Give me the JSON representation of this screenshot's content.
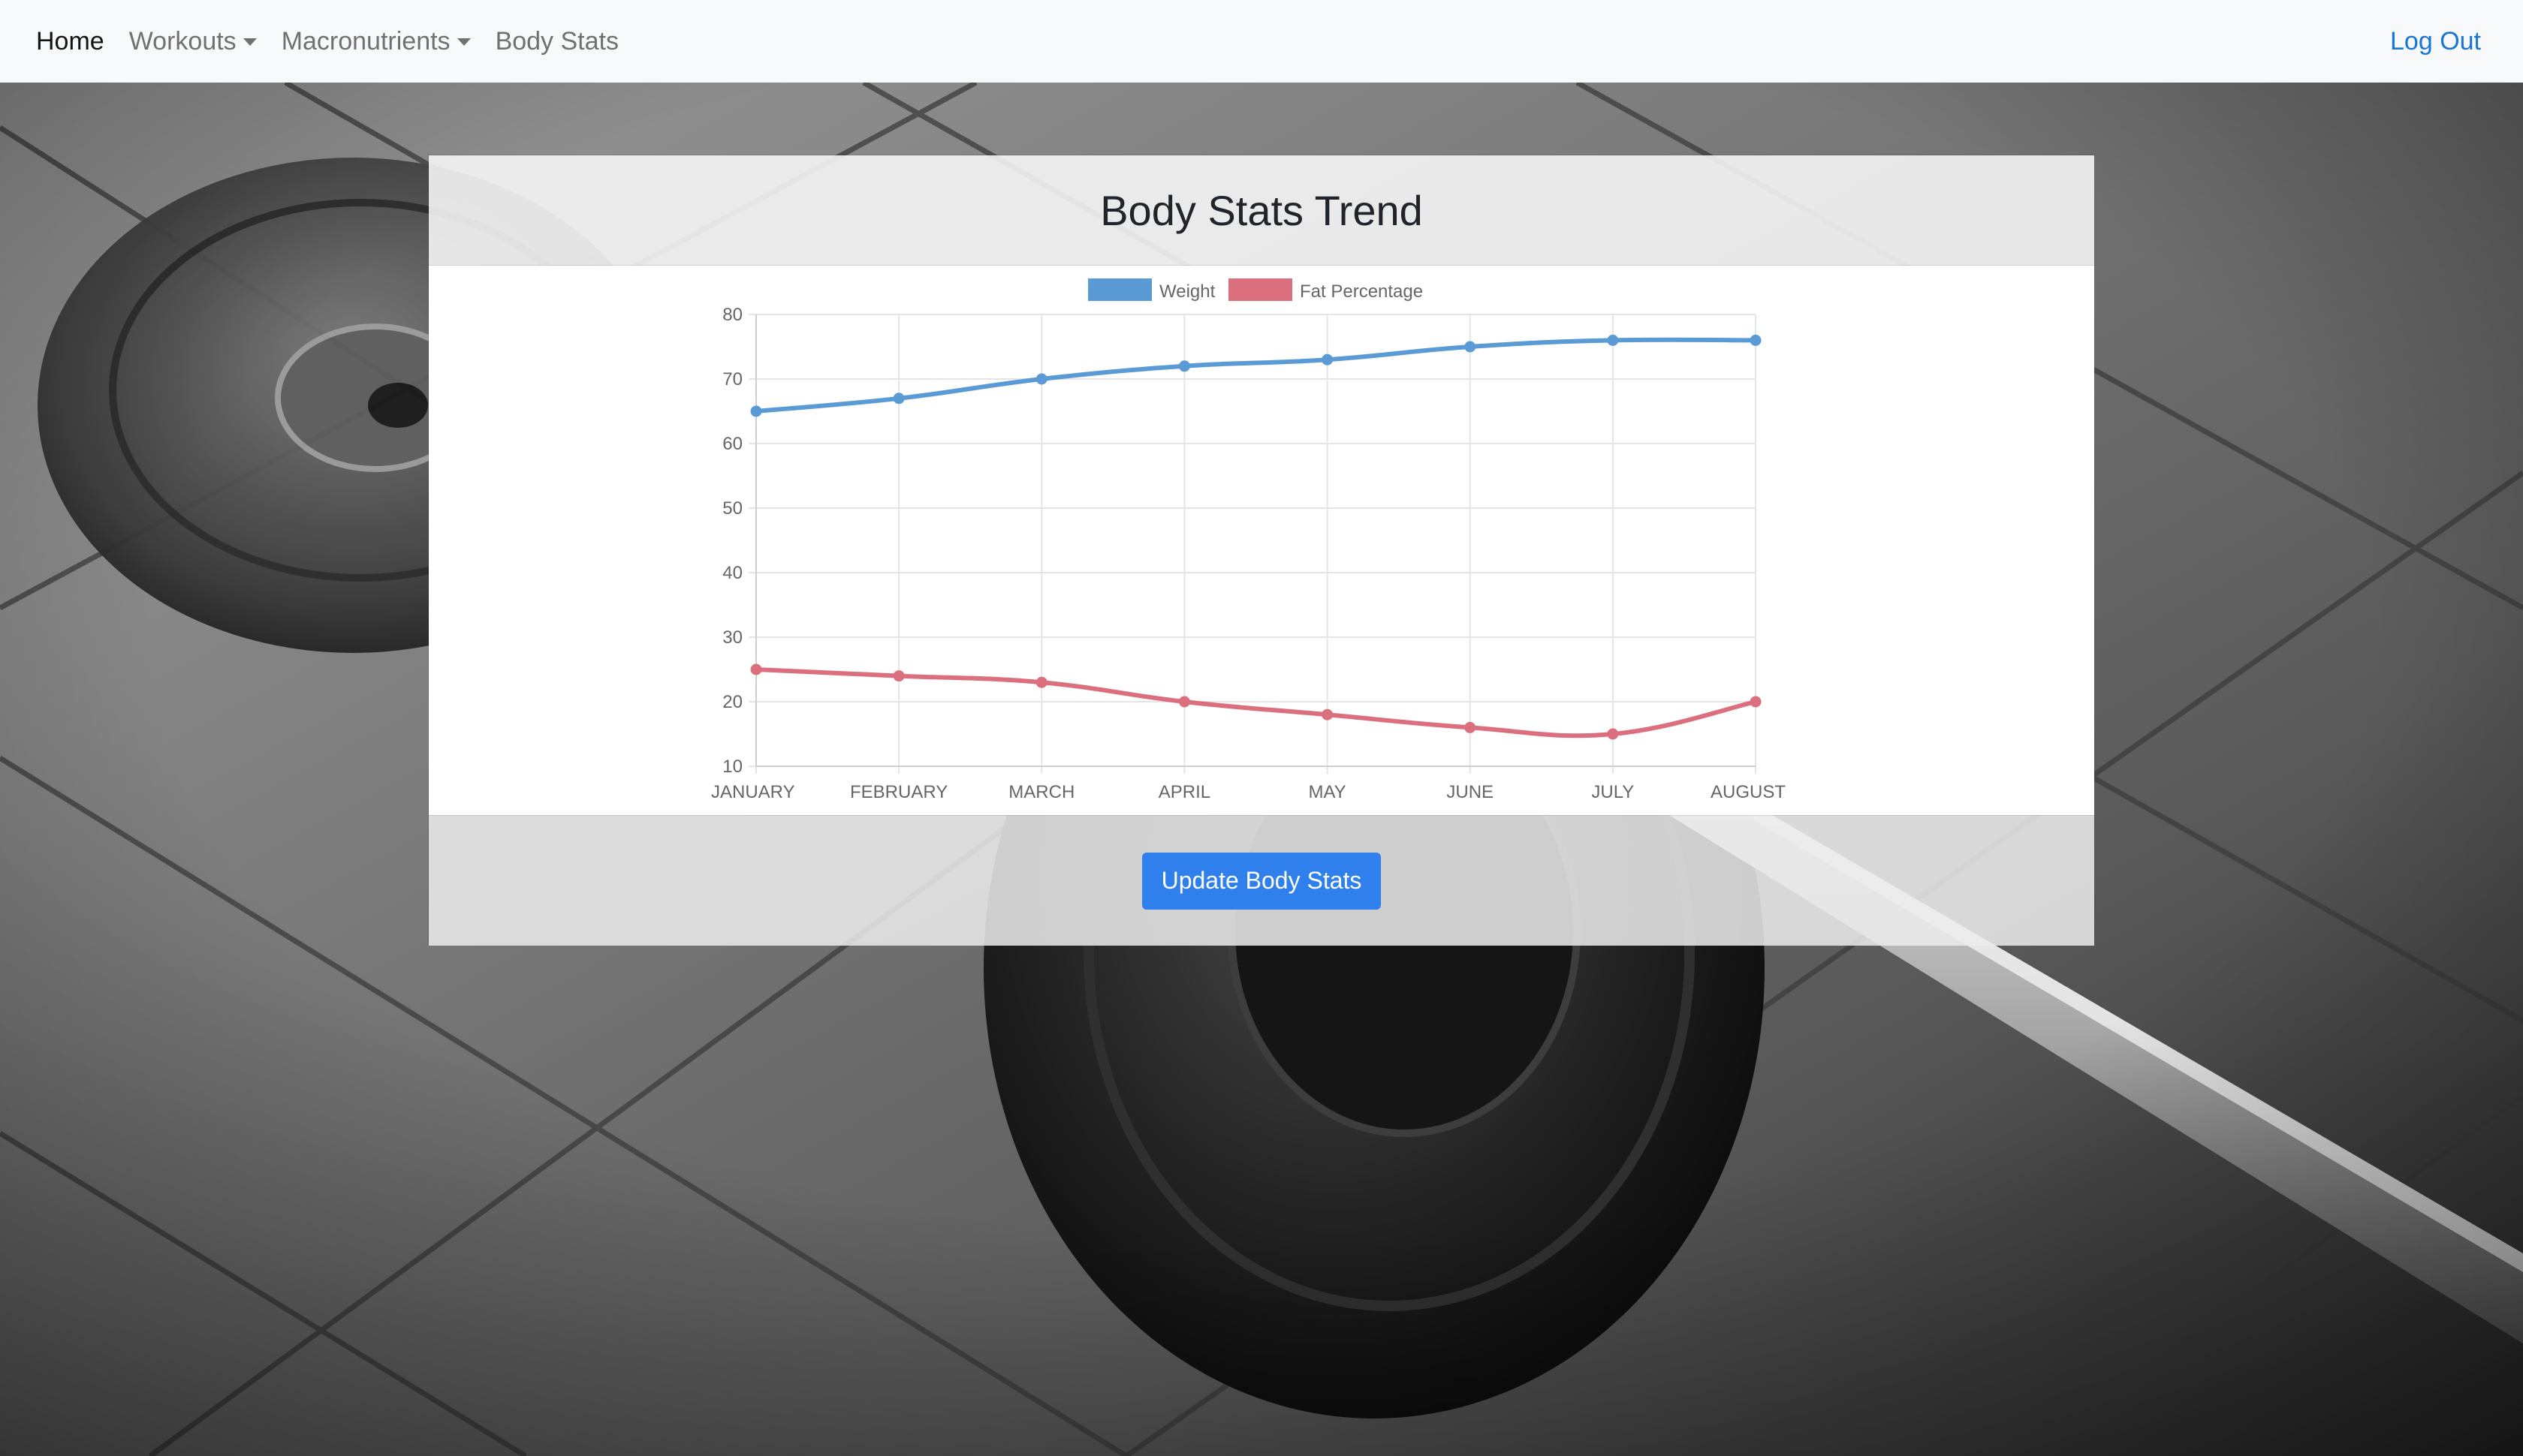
{
  "nav": {
    "items": [
      {
        "label": "Home",
        "active": true,
        "dropdown": false
      },
      {
        "label": "Workouts",
        "active": false,
        "dropdown": true
      },
      {
        "label": "Macronutrients",
        "active": false,
        "dropdown": true
      },
      {
        "label": "Body Stats",
        "active": false,
        "dropdown": false
      }
    ],
    "logout_label": "Log Out"
  },
  "card": {
    "title": "Body Stats Trend",
    "button_label": "Update Body Stats"
  },
  "colors": {
    "weight": "#5b9bd5",
    "fat": "#dc6f7e",
    "accent_button": "#2f80ed",
    "link": "#1976d2"
  },
  "chart_data": {
    "type": "line",
    "categories": [
      "JANUARY",
      "FEBRUARY",
      "MARCH",
      "APRIL",
      "MAY",
      "JUNE",
      "JULY",
      "AUGUST"
    ],
    "series": [
      {
        "name": "Weight",
        "values": [
          65,
          67,
          70,
          72,
          73,
          75,
          76,
          76
        ]
      },
      {
        "name": "Fat Percentage",
        "values": [
          25,
          24,
          23,
          20,
          18,
          16,
          15,
          20
        ]
      }
    ],
    "ylim": [
      10,
      80
    ],
    "yticks": [
      10,
      20,
      30,
      40,
      50,
      60,
      70,
      80
    ],
    "grid": true,
    "legend": "top-center",
    "title": "",
    "xlabel": "",
    "ylabel": ""
  }
}
